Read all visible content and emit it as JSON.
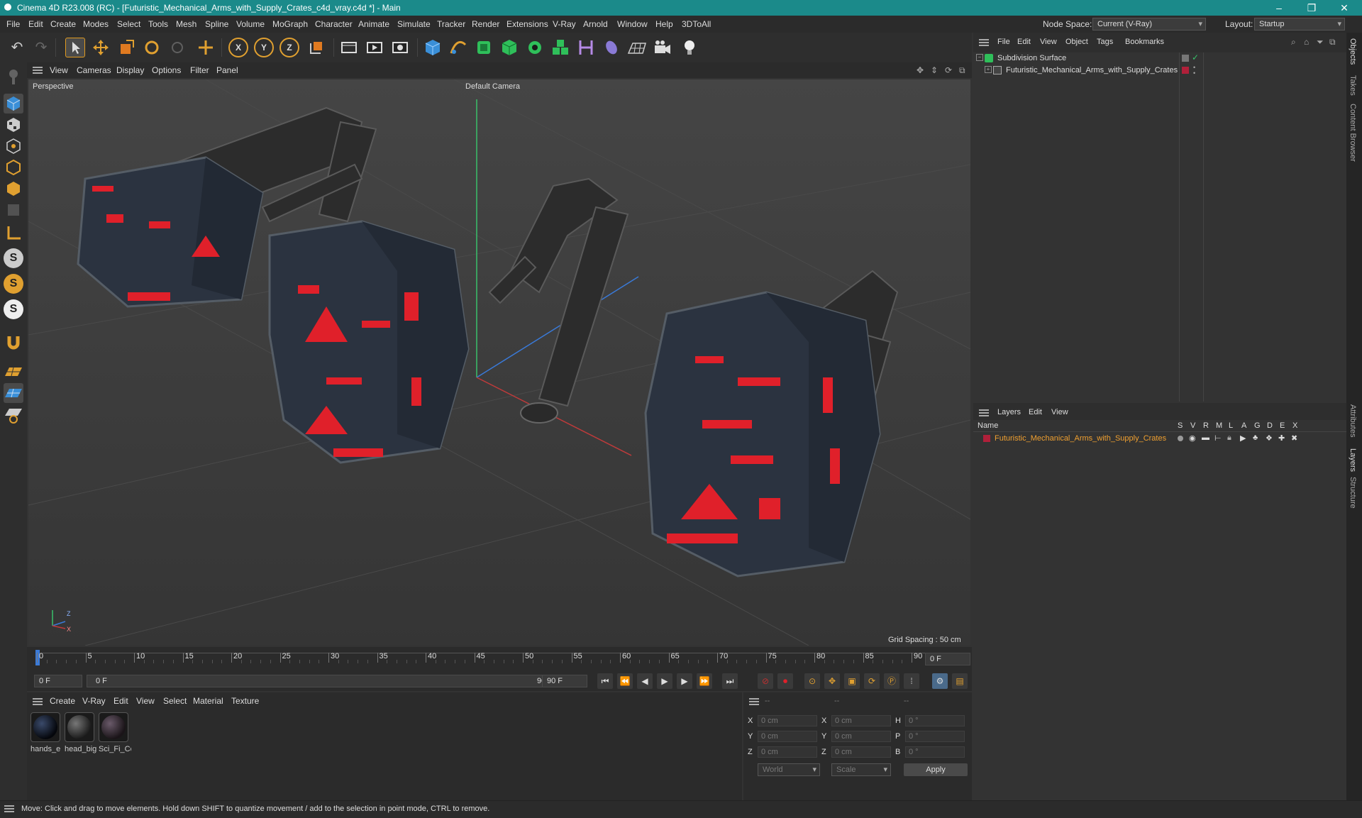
{
  "window": {
    "title": "Cinema 4D R23.008 (RC) - [Futuristic_Mechanical_Arms_with_Supply_Crates_c4d_vray.c4d *] - Main",
    "minimize": "–",
    "maximize": "❐",
    "close": "✕"
  },
  "menubar": {
    "items": [
      "File",
      "Edit",
      "Create",
      "Modes",
      "Select",
      "Tools",
      "Mesh",
      "Spline",
      "Volume",
      "MoGraph",
      "Character",
      "Animate",
      "Simulate",
      "Tracker",
      "Render",
      "Extensions",
      "V-Ray",
      "Arnold",
      "Window",
      "Help",
      "3DToAll"
    ],
    "node_space_label": "Node Space:",
    "node_space_value": "Current (V-Ray)",
    "layout_label": "Layout:",
    "layout_value": "Startup"
  },
  "toolbar": {
    "axis_x": "X",
    "axis_y": "Y",
    "axis_z": "Z"
  },
  "left_toolbar": {
    "s1": "S",
    "s2": "S",
    "s3": "S"
  },
  "viewport": {
    "menu": [
      "View",
      "Cameras",
      "Display",
      "Options",
      "Filter",
      "Panel"
    ],
    "label": "Perspective",
    "camera": "Default Camera",
    "grid_spacing": "Grid Spacing : 50 cm",
    "axis_z": "Z",
    "axis_x": "X"
  },
  "timeline": {
    "ticks": [
      "0",
      "5",
      "10",
      "15",
      "20",
      "25",
      "30",
      "35",
      "40",
      "45",
      "50",
      "55",
      "60",
      "65",
      "70",
      "75",
      "80",
      "85",
      "90"
    ],
    "current_frame_right": "0 F",
    "start_field": "0 F",
    "range_start": "0 F",
    "range_end": "90 F",
    "end_field": "90 F"
  },
  "materials": {
    "menu": [
      "Create",
      "V-Ray",
      "Edit",
      "View",
      "Select",
      "Material",
      "Texture"
    ],
    "items": [
      {
        "label": "hands_e"
      },
      {
        "label": "head_big"
      },
      {
        "label": "Sci_Fi_Cc"
      }
    ]
  },
  "coordinates": {
    "headers": [
      "--",
      "--",
      "--"
    ],
    "rows": [
      {
        "l1": "X",
        "v1": "0 cm",
        "l2": "X",
        "v2": "0 cm",
        "l3": "H",
        "v3": "0 °"
      },
      {
        "l1": "Y",
        "v1": "0 cm",
        "l2": "Y",
        "v2": "0 cm",
        "l3": "P",
        "v3": "0 °"
      },
      {
        "l1": "Z",
        "v1": "0 cm",
        "l2": "Z",
        "v2": "0 cm",
        "l3": "B",
        "v3": "0 °"
      }
    ],
    "world": "World",
    "scale": "Scale",
    "apply": "Apply"
  },
  "objects_panel": {
    "menu": [
      "File",
      "Edit",
      "View",
      "Object",
      "Tags",
      "Bookmarks"
    ],
    "items": [
      {
        "name": "Subdivision Surface"
      },
      {
        "name": "Futuristic_Mechanical_Arms_with_Supply_Crates"
      }
    ]
  },
  "layers_panel": {
    "menu": [
      "Layers",
      "Edit",
      "View"
    ],
    "columns": [
      "Name",
      "S",
      "V",
      "R",
      "M",
      "L",
      "A",
      "G",
      "D",
      "E",
      "X"
    ],
    "rows": [
      {
        "name": "Futuristic_Mechanical_Arms_with_Supply_Crates",
        "color": "#b0203a"
      }
    ]
  },
  "right_strip": {
    "tabs_top": [
      "Objects",
      "Takes",
      "Content Browser"
    ],
    "tabs_bottom": [
      "Attributes",
      "Layers",
      "Structure"
    ]
  },
  "status": {
    "text": "Move: Click and drag to move elements. Hold down SHIFT to quantize movement / add to the selection in point mode, CTRL to remove."
  },
  "colors": {
    "accent_teal": "#1b8a8a",
    "layer_orange": "#f0a030",
    "crate_red": "#e0202a"
  }
}
